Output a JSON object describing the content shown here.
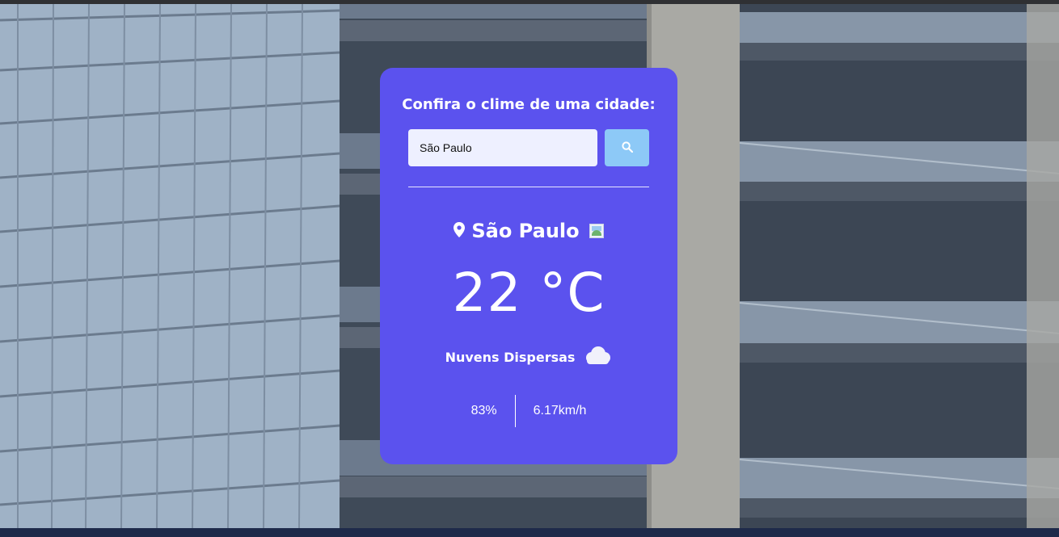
{
  "card": {
    "title": "Confira o clime de uma cidade:",
    "search": {
      "value": "São Paulo",
      "button_icon": "search-icon"
    },
    "location": {
      "icon": "map-pin-icon",
      "city": "São Paulo",
      "flag_icon": "broken-image-icon"
    },
    "temperature": "22 °C",
    "description": {
      "text": "Nuvens Dispersas",
      "icon": "cloud-icon"
    },
    "humidity": "83%",
    "wind": "6.17km/h"
  },
  "colors": {
    "card_background": "#5b52ee",
    "search_button": "#8dc9f7",
    "input_background": "#eef0ff",
    "text": "#ffffff"
  }
}
